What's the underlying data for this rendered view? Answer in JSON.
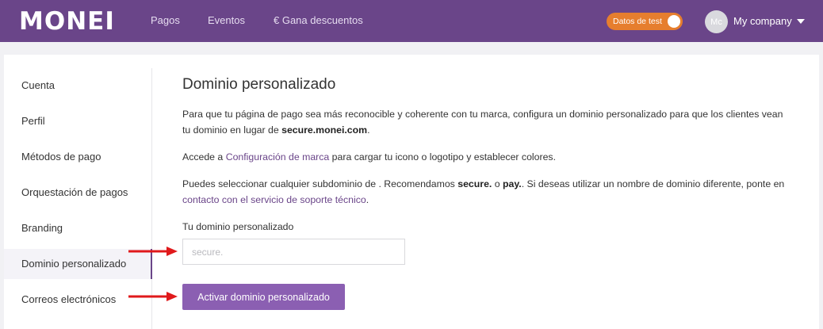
{
  "brand": {
    "logo": "MONEI"
  },
  "nav": {
    "pagos": "Pagos",
    "eventos": "Eventos",
    "descuentos": "€ Gana descuentos"
  },
  "test_toggle": {
    "label": "Datos de test",
    "on": true
  },
  "user": {
    "avatar_initials": "Mc",
    "company": "My company"
  },
  "sidebar": {
    "items": [
      {
        "label": "Cuenta"
      },
      {
        "label": "Perfil"
      },
      {
        "label": "Métodos de pago"
      },
      {
        "label": "Orquestación de pagos"
      },
      {
        "label": "Branding"
      },
      {
        "label": "Dominio personalizado",
        "active": true
      },
      {
        "label": "Correos electrónicos"
      }
    ]
  },
  "main": {
    "title": "Dominio personalizado",
    "p1_text": "Para que tu página de pago sea más reconocible y coherente con tu marca, configura un dominio personalizado para que los clientes vean tu dominio en lugar de ",
    "p1_domain": "secure.monei.com",
    "p1_end": ".",
    "p2_start": "Accede a ",
    "p2_link": "Configuración de marca",
    "p2_end": " para cargar tu icono o logotipo y establecer colores.",
    "p3_start": "Puedes seleccionar cualquier subdominio de . Recomendamos ",
    "p3_b1": "secure.",
    "p3_mid": " o ",
    "p3_b2": "pay.",
    "p3_mid2": ". Si deseas utilizar un nombre de dominio diferente, ponte en ",
    "p3_link": "contacto con el servicio de soporte técnico",
    "p3_end": ".",
    "field_label": "Tu dominio personalizado",
    "field_placeholder": "secure.",
    "field_value": "",
    "button_label": "Activar dominio personalizado"
  },
  "colors": {
    "brand_purple": "#6a4589",
    "button_purple": "#8b5fb2",
    "toggle_orange": "#e67e2e",
    "arrow_red": "#e0191b"
  }
}
